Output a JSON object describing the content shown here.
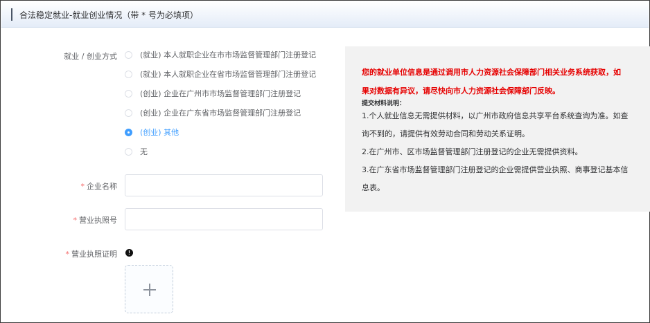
{
  "header": {
    "title": "合法稳定就业-就业创业情况（带 * 号为必填项）"
  },
  "form": {
    "employment_mode": {
      "label": "就业 / 创业方式",
      "options": [
        {
          "text": "(就业) 本人就职企业在市市场监督管理部门注册登记",
          "selected": false
        },
        {
          "text": "(就业) 本人就职企业在省市场监督管理部门注册登记",
          "selected": false
        },
        {
          "text": "(创业) 企业在广州市市场监督管理部门注册登记",
          "selected": false
        },
        {
          "text": "(创业) 企业在广东省市场监督管理部门注册登记",
          "selected": false
        },
        {
          "text": "(创业) 其他",
          "selected": true
        },
        {
          "text": "无",
          "selected": false
        }
      ]
    },
    "company_name": {
      "required_mark": "*",
      "label": "企业名称",
      "value": ""
    },
    "license_no": {
      "required_mark": "*",
      "label": "营业执照号",
      "value": ""
    },
    "license_proof": {
      "required_mark": "*",
      "label": "营业执照证明",
      "upload_symbol": "+"
    }
  },
  "notice": {
    "warning_line1": "您的就业单位信息是通过调用市人力资源社会保障部门相关业务系统获取，如",
    "warning_line2": "果对数据有异议，请尽快向市人力资源社会保障部门反映。",
    "materials_title": "提交材料说明：",
    "lines": [
      "1.个人就业信息无需提供材料，以广州市政府信息共享平台系统查询为准。如查",
      "询不到的，请提供有效劳动合同和劳动关系证明。",
      "2.在广州市、区市场监督管理部门注册登记的企业无需提供资料。",
      "3.在广东省市场监督管理部门注册登记的企业需提供营业执照、商事登记基本信",
      "息表。"
    ]
  },
  "colors": {
    "accent": "#409eff",
    "required": "#f56c6c",
    "warning": "#e60000"
  },
  "icons": {
    "info": "exclamation-circle-icon",
    "upload": "plus-icon"
  }
}
